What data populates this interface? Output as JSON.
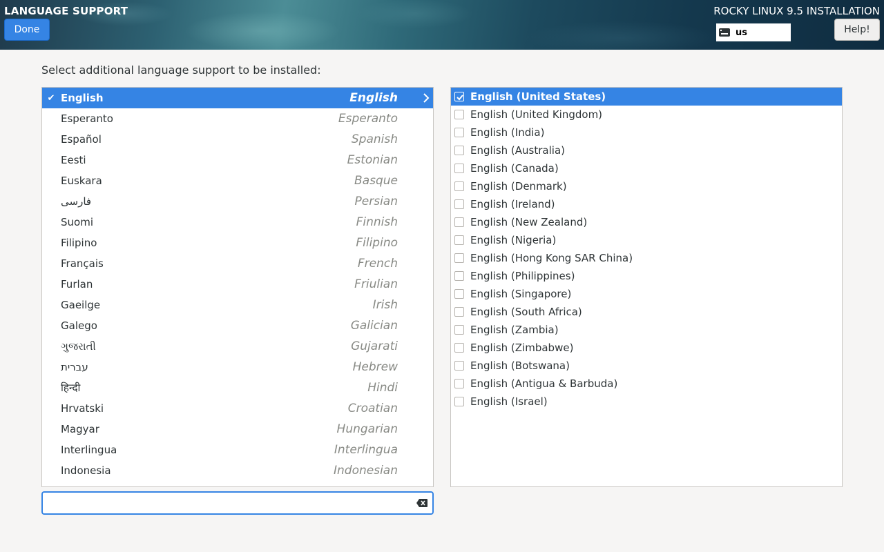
{
  "header": {
    "title": "LANGUAGE SUPPORT",
    "done_label": "Done",
    "install_title": "ROCKY LINUX 9.5 INSTALLATION",
    "keyboard_layout": "us",
    "help_label": "Help!"
  },
  "instruction": "Select additional language support to be installed:",
  "languages": [
    {
      "native": "English",
      "english": "English",
      "selected": true
    },
    {
      "native": "Esperanto",
      "english": "Esperanto"
    },
    {
      "native": "Español",
      "english": "Spanish"
    },
    {
      "native": "Eesti",
      "english": "Estonian"
    },
    {
      "native": "Euskara",
      "english": "Basque"
    },
    {
      "native": "فارسی",
      "english": "Persian"
    },
    {
      "native": "Suomi",
      "english": "Finnish"
    },
    {
      "native": "Filipino",
      "english": "Filipino"
    },
    {
      "native": "Français",
      "english": "French"
    },
    {
      "native": "Furlan",
      "english": "Friulian"
    },
    {
      "native": "Gaeilge",
      "english": "Irish"
    },
    {
      "native": "Galego",
      "english": "Galician"
    },
    {
      "native": "ગુજરાતી",
      "english": "Gujarati"
    },
    {
      "native": "עברית",
      "english": "Hebrew"
    },
    {
      "native": "हिन्दी",
      "english": "Hindi"
    },
    {
      "native": "Hrvatski",
      "english": "Croatian"
    },
    {
      "native": "Magyar",
      "english": "Hungarian"
    },
    {
      "native": "Interlingua",
      "english": "Interlingua"
    },
    {
      "native": "Indonesia",
      "english": "Indonesian"
    }
  ],
  "search": {
    "value": "",
    "placeholder": ""
  },
  "locales": [
    {
      "label": "English (United States)",
      "checked": true
    },
    {
      "label": "English (United Kingdom)"
    },
    {
      "label": "English (India)"
    },
    {
      "label": "English (Australia)"
    },
    {
      "label": "English (Canada)"
    },
    {
      "label": "English (Denmark)"
    },
    {
      "label": "English (Ireland)"
    },
    {
      "label": "English (New Zealand)"
    },
    {
      "label": "English (Nigeria)"
    },
    {
      "label": "English (Hong Kong SAR China)"
    },
    {
      "label": "English (Philippines)"
    },
    {
      "label": "English (Singapore)"
    },
    {
      "label": "English (South Africa)"
    },
    {
      "label": "English (Zambia)"
    },
    {
      "label": "English (Zimbabwe)"
    },
    {
      "label": "English (Botswana)"
    },
    {
      "label": "English (Antigua & Barbuda)"
    },
    {
      "label": "English (Israel)"
    }
  ],
  "colors": {
    "accent": "#3584e4",
    "background": "#f6f5f4"
  }
}
